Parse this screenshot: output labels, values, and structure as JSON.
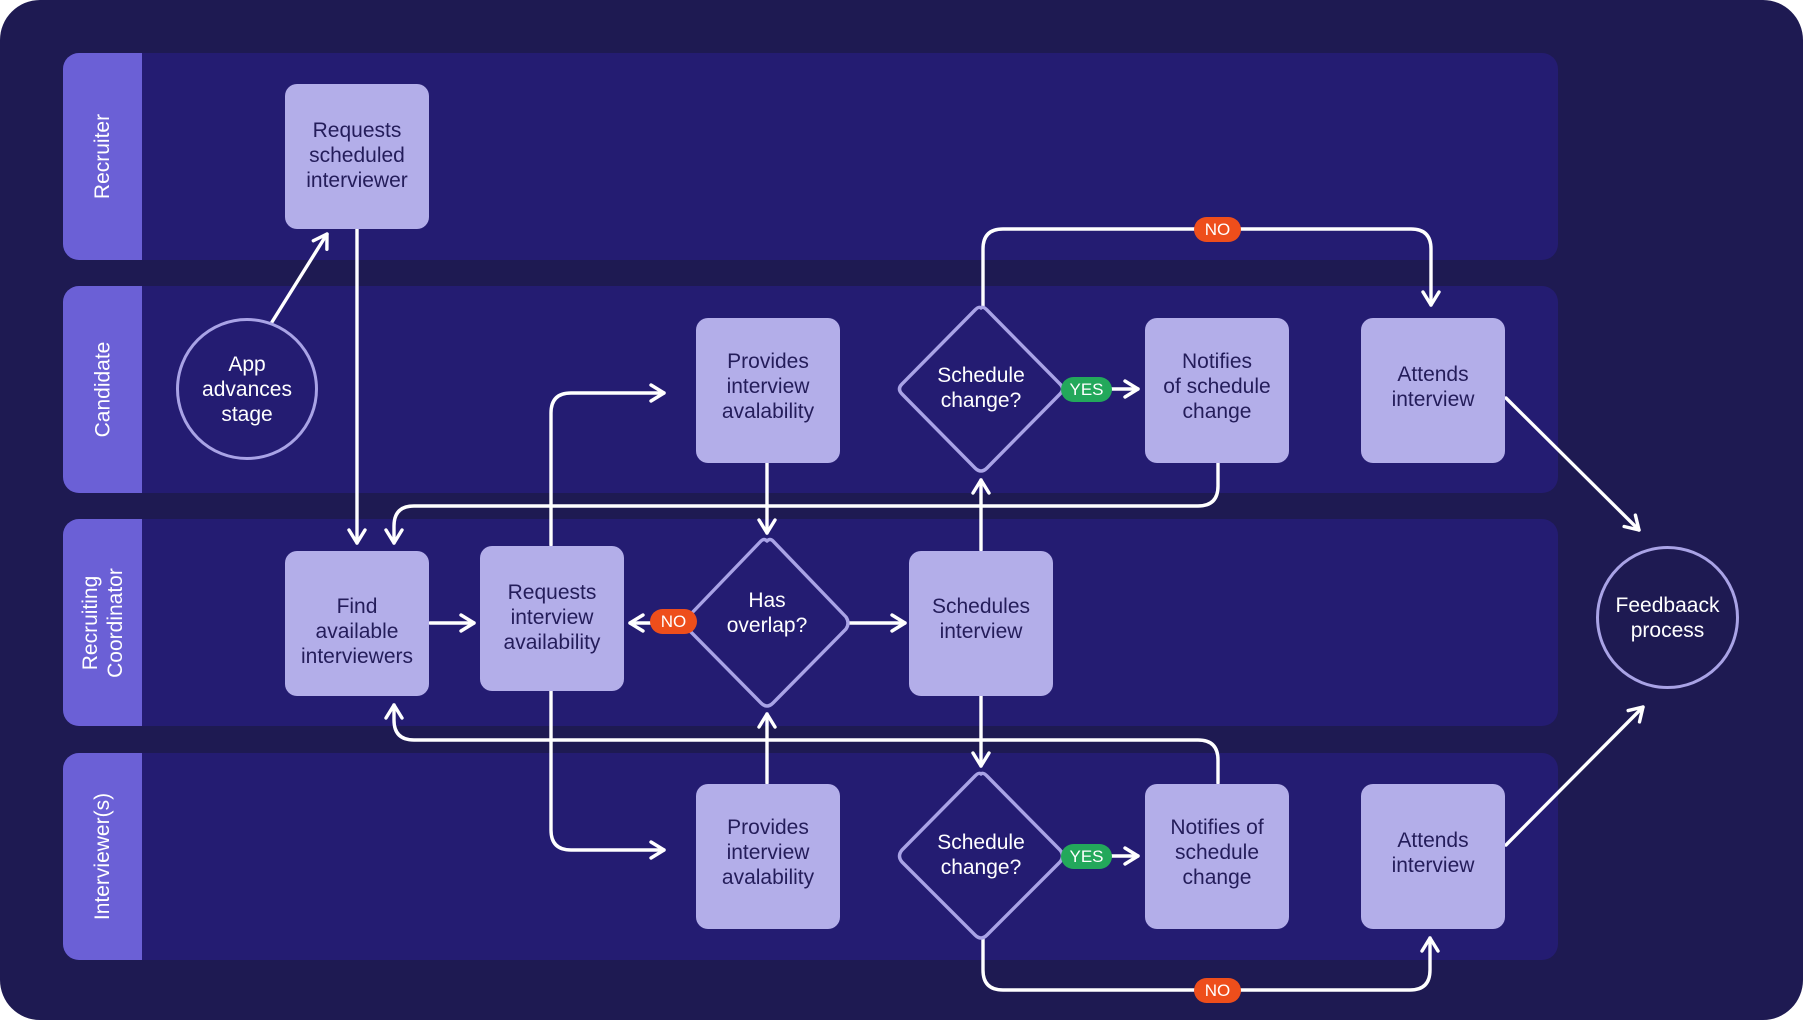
{
  "diagram": {
    "type": "swimlane-flowchart",
    "colors": {
      "background": "#1e1a52",
      "lane": "#241c72",
      "lane_label": "#6b60d6",
      "process_box": "#b3aee9",
      "process_text": "#241d5a",
      "outline": "#a9a3e6",
      "connector": "#ffffff",
      "no_badge": "#ee4e1b",
      "yes_badge": "#23a85b"
    },
    "lanes": [
      {
        "id": "recruiter",
        "label": "Recruiter"
      },
      {
        "id": "candidate",
        "label": "Candidate"
      },
      {
        "id": "coordinator",
        "label": "Recruiting Coordinator",
        "label_lines": [
          "Recruiting",
          "Coordinator"
        ]
      },
      {
        "id": "interviewers",
        "label": "Interviewer(s)"
      }
    ],
    "nodes": {
      "app_advances": {
        "lane": "candidate",
        "shape": "circle",
        "label": "App advances stage",
        "lines": [
          "App",
          "advances",
          "stage"
        ]
      },
      "requests_scheduled": {
        "lane": "recruiter",
        "shape": "box",
        "label": "Requests scheduled interviewer",
        "lines": [
          "Requests",
          "scheduled",
          "interviewer"
        ]
      },
      "find_available": {
        "lane": "coordinator",
        "shape": "box",
        "label": "Find available interviewers",
        "lines": [
          "Find",
          "available",
          "interviewers"
        ]
      },
      "requests_availability": {
        "lane": "coordinator",
        "shape": "box",
        "label": "Requests interview availability",
        "lines": [
          "Requests",
          "interview",
          "availability"
        ]
      },
      "candidate_provides": {
        "lane": "candidate",
        "shape": "box",
        "label": "Provides interview avalability",
        "lines": [
          "Provides",
          "interview",
          "avalability"
        ]
      },
      "interviewer_provides": {
        "lane": "interviewers",
        "shape": "box",
        "label": "Provides interview avalability",
        "lines": [
          "Provides",
          "interview",
          "avalability"
        ]
      },
      "has_overlap": {
        "lane": "coordinator",
        "shape": "diamond",
        "label": "Has overlap?",
        "lines": [
          "Has",
          "overlap?"
        ]
      },
      "schedules_interview": {
        "lane": "coordinator",
        "shape": "box",
        "label": "Schedules interview",
        "lines": [
          "Schedules",
          "interview"
        ]
      },
      "candidate_schedule_change": {
        "lane": "candidate",
        "shape": "diamond",
        "label": "Schedule change?",
        "lines": [
          "Schedule",
          "change?"
        ]
      },
      "interviewer_schedule_change": {
        "lane": "interviewers",
        "shape": "diamond",
        "label": "Schedule change?",
        "lines": [
          "Schedule",
          "change?"
        ]
      },
      "candidate_notifies": {
        "lane": "candidate",
        "shape": "box",
        "label": "Notifies of schedule change",
        "lines": [
          "Notifies",
          "of schedule",
          "change"
        ]
      },
      "interviewer_notifies": {
        "lane": "interviewers",
        "shape": "box",
        "label": "Notifies of schedule change",
        "lines": [
          "Notifies of",
          "schedule",
          "change"
        ]
      },
      "candidate_attends": {
        "lane": "candidate",
        "shape": "box",
        "label": "Attends interview",
        "lines": [
          "Attends",
          "interview"
        ]
      },
      "interviewer_attends": {
        "lane": "interviewers",
        "shape": "box",
        "label": "Attends interview",
        "lines": [
          "Attends",
          "interview"
        ]
      },
      "feedback": {
        "shape": "circle",
        "label": "Feedbaack process",
        "lines": [
          "Feedbaack",
          "process"
        ]
      }
    },
    "badges": {
      "no": "NO",
      "yes": "YES"
    },
    "edges": [
      {
        "from": "app_advances",
        "to": "requests_scheduled"
      },
      {
        "from": "requests_scheduled",
        "to": "find_available"
      },
      {
        "from": "find_available",
        "to": "requests_availability"
      },
      {
        "from": "requests_availability",
        "to": "candidate_provides"
      },
      {
        "from": "requests_availability",
        "to": "interviewer_provides"
      },
      {
        "from": "candidate_provides",
        "to": "has_overlap"
      },
      {
        "from": "interviewer_provides",
        "to": "has_overlap"
      },
      {
        "from": "has_overlap",
        "to": "requests_availability",
        "label": "NO"
      },
      {
        "from": "has_overlap",
        "to": "schedules_interview"
      },
      {
        "from": "schedules_interview",
        "to": "candidate_schedule_change"
      },
      {
        "from": "schedules_interview",
        "to": "interviewer_schedule_change"
      },
      {
        "from": "candidate_schedule_change",
        "to": "candidate_notifies",
        "label": "YES"
      },
      {
        "from": "candidate_schedule_change",
        "to": "candidate_attends",
        "label": "NO"
      },
      {
        "from": "interviewer_schedule_change",
        "to": "interviewer_notifies",
        "label": "YES"
      },
      {
        "from": "interviewer_schedule_change",
        "to": "interviewer_attends",
        "label": "NO"
      },
      {
        "from": "candidate_notifies",
        "to": "find_available"
      },
      {
        "from": "interviewer_notifies",
        "to": "find_available"
      },
      {
        "from": "candidate_attends",
        "to": "feedback"
      },
      {
        "from": "interviewer_attends",
        "to": "feedback"
      }
    ]
  }
}
